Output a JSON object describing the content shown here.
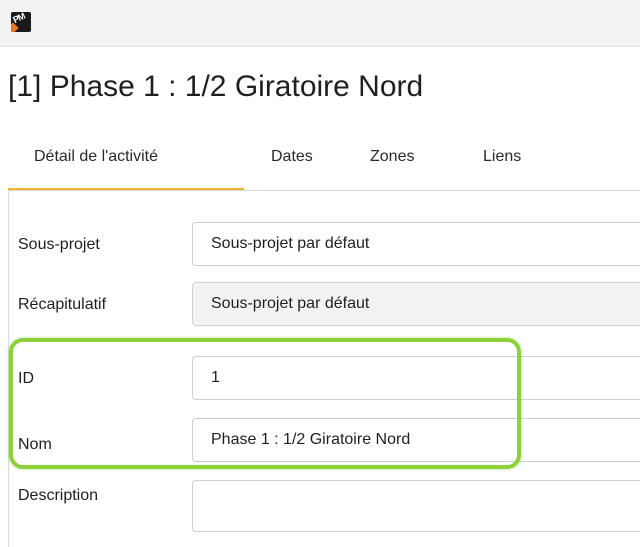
{
  "app": {
    "icon": "app-logo-icon"
  },
  "window": {
    "title": "[1] Phase 1 : 1/2 Giratoire Nord"
  },
  "tabs": [
    {
      "label": "Détail de l'activité",
      "active": true
    },
    {
      "label": "Dates",
      "active": false
    },
    {
      "label": "Zones",
      "active": false
    },
    {
      "label": "Liens",
      "active": false
    }
  ],
  "form": {
    "fields": [
      {
        "label": "Sous-projet",
        "value": "Sous-projet par défaut"
      },
      {
        "label": "Récapitulatif",
        "value": "Sous-projet par défaut"
      },
      {
        "label": "ID",
        "value": "1"
      },
      {
        "label": "Nom",
        "value": "Phase 1 : 1/2 Giratoire Nord"
      },
      {
        "label": "Description",
        "value": ""
      }
    ]
  },
  "colors": {
    "accent_tab": "#f0b429",
    "highlight": "#8cd13a",
    "readonly_field": "#f2f2f2"
  }
}
